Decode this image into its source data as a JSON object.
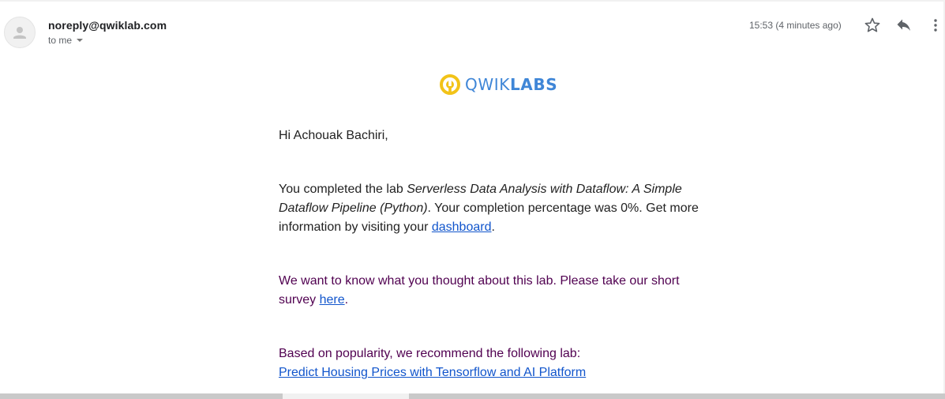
{
  "header": {
    "sender": "noreply@qwiklab.com",
    "recipient_label": "to me",
    "timestamp": "15:53 (4 minutes ago)",
    "icons": [
      "person-icon",
      "star-icon",
      "reply-icon",
      "more-vert-icon"
    ]
  },
  "logo": {
    "text_light": "QWIK",
    "text_bold": "LABS",
    "colors": {
      "ring": "#f2c318",
      "text": "#3f86d7"
    }
  },
  "message": {
    "greeting": "Hi Achouak Bachiri,",
    "p1_before": "You completed the lab ",
    "p1_lab_title": "Serverless Data Analysis with Dataflow: A Simple Dataflow Pipeline (Python)",
    "p1_middle": ". Your completion percentage was 0%. Get more information by visiting your ",
    "p1_link": "dashboard",
    "p1_after": ".",
    "p2_before": "We want to know what you thought about this lab. Please take our short survey ",
    "p2_link": "here",
    "p2_after": ".",
    "p3_text": "Based on popularity, we recommend the following lab:",
    "p3_link": "Predict Housing Prices with Tensorflow and AI Platform"
  },
  "colors": {
    "link": "#1155cc",
    "quoted_text": "#500050",
    "body_text": "#222222"
  }
}
